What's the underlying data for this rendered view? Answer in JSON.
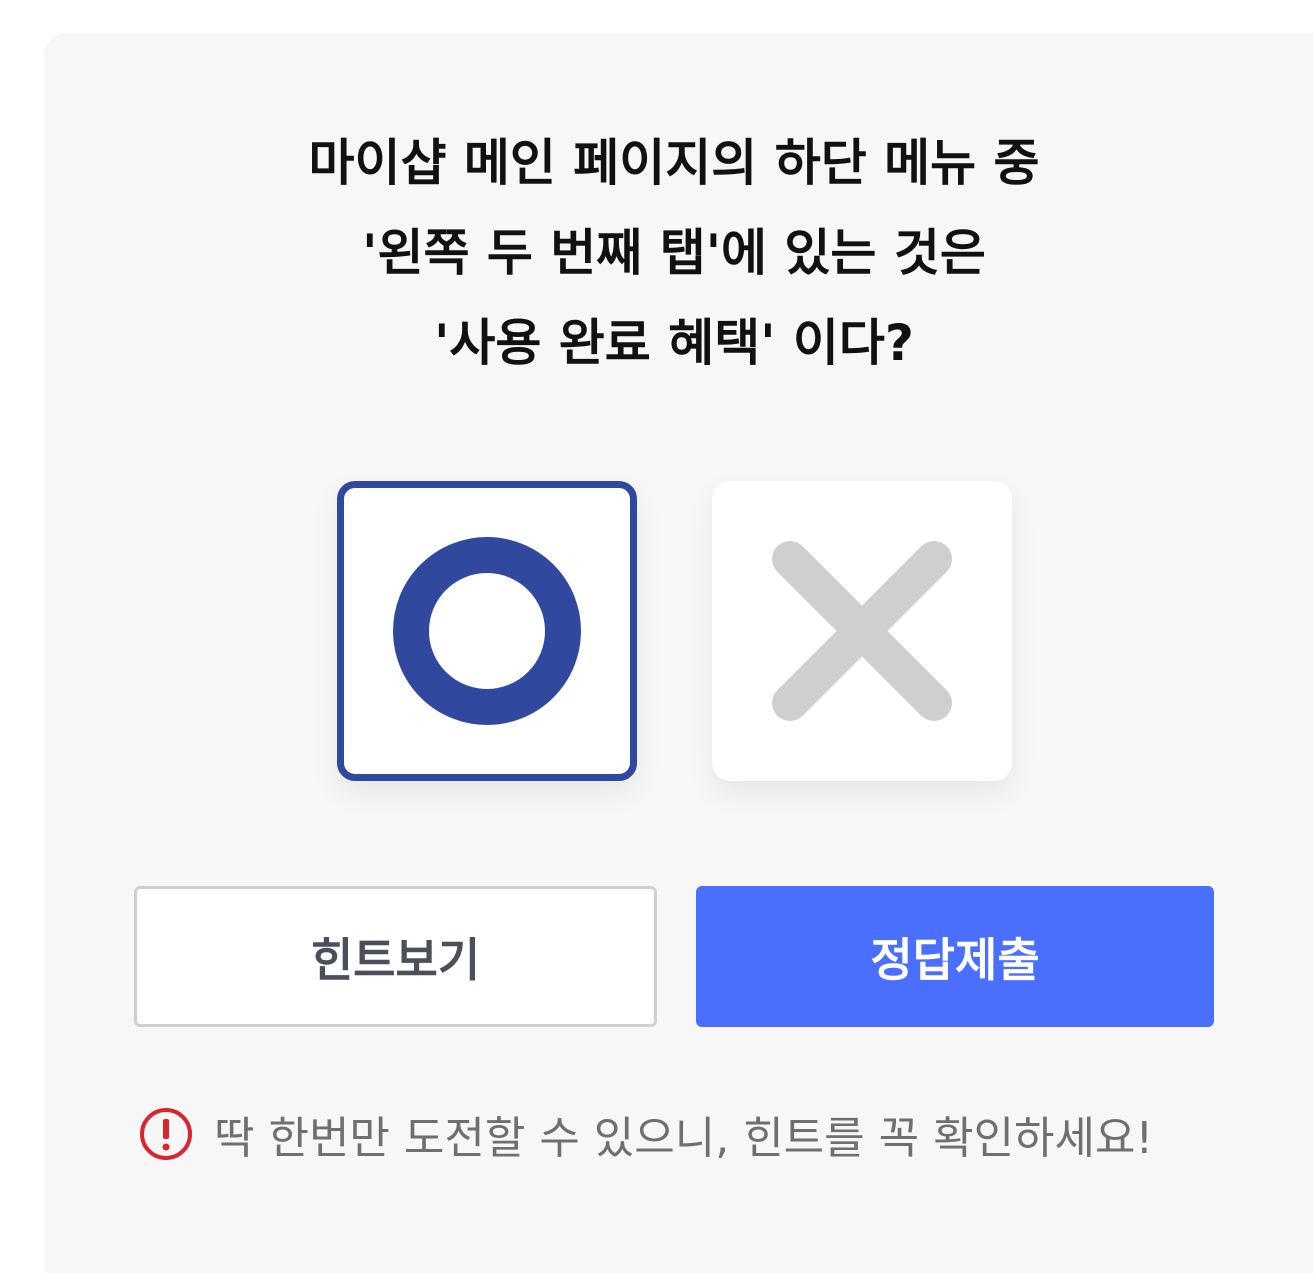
{
  "question": {
    "lines": [
      "마이샵 메인 페이지의 하단 메뉴 중",
      "'왼쪽 두 번째 탭'에 있는 것은",
      "'사용 완료 혜택' 이다?"
    ]
  },
  "choices": {
    "o": {
      "icon": "circle-o-icon",
      "selected": true,
      "color": "#31489f"
    },
    "x": {
      "icon": "x-mark-icon",
      "selected": false,
      "color": "#cfcfcf"
    }
  },
  "buttons": {
    "hint_label": "힌트보기",
    "submit_label": "정답제출"
  },
  "notice": {
    "icon": "warning-circle-icon",
    "text": "딱 한번만 도전할 수 있으니, 힌트를 꼭 확인하세요!"
  },
  "colors": {
    "accent": "#4a6ffd",
    "selected_border": "#31489f",
    "warning": "#d9252f"
  }
}
